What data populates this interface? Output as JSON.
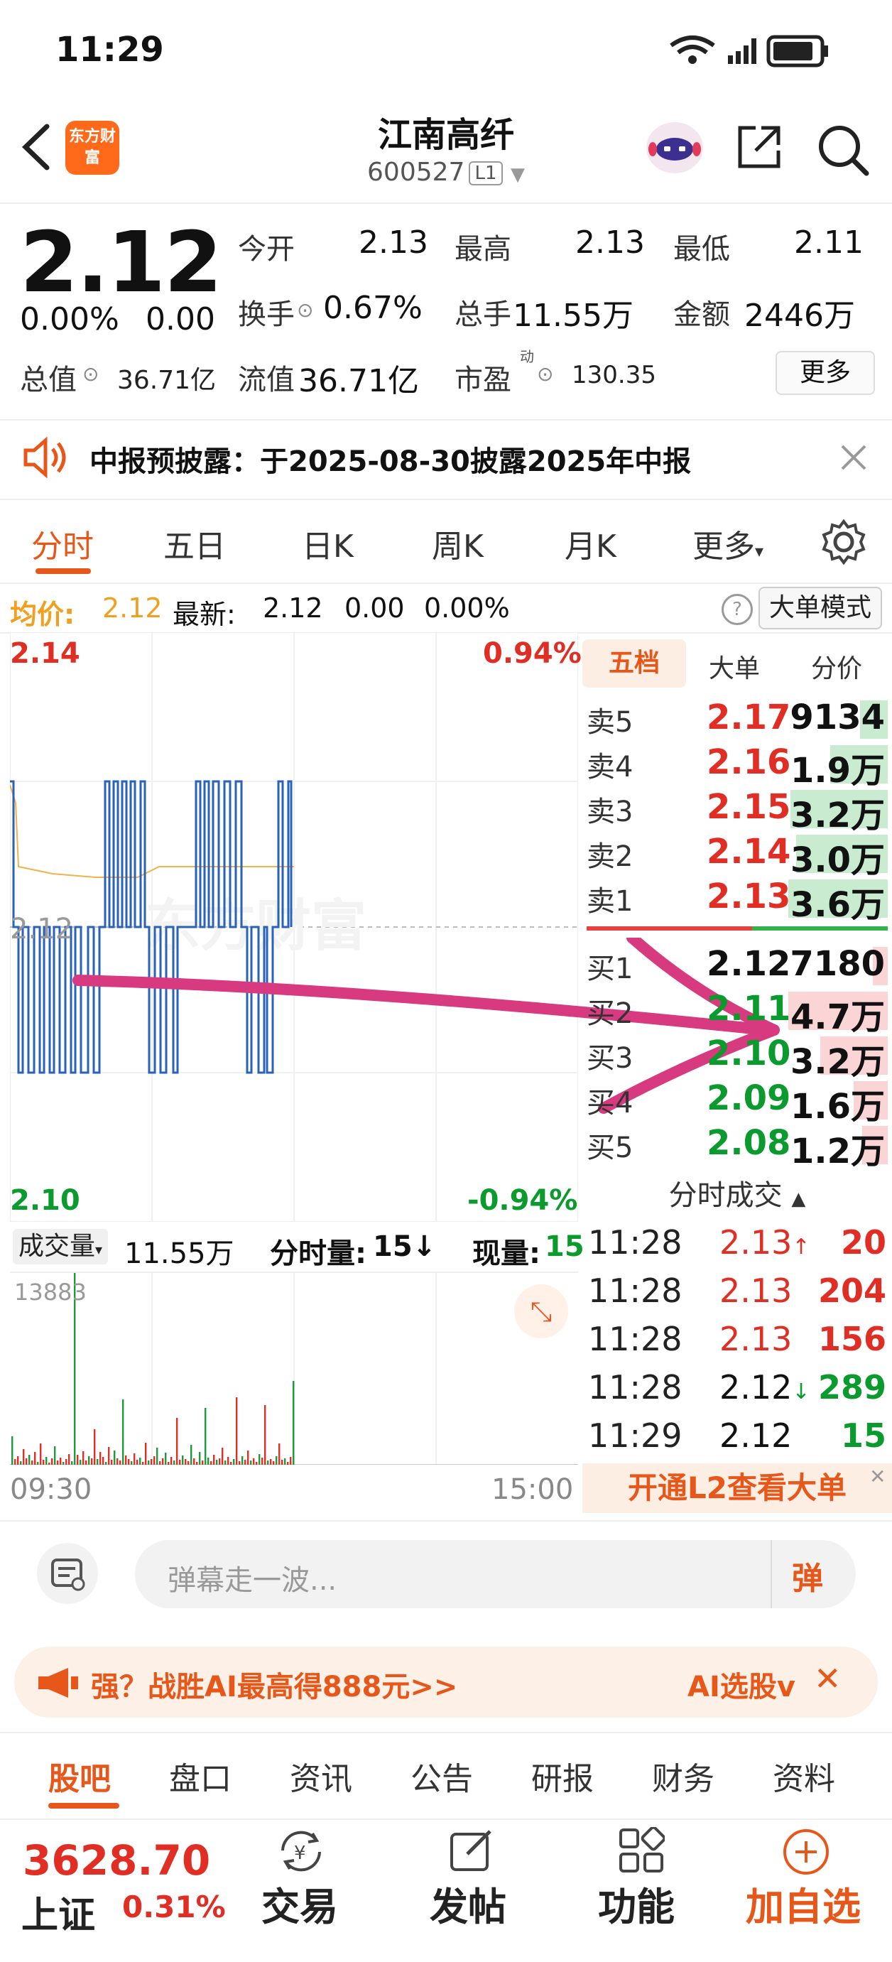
{
  "status": {
    "time": "11:29"
  },
  "header": {
    "logo": "东方财富",
    "title": "江南高纤",
    "code": "600527",
    "level": "L1"
  },
  "quote": {
    "price": "2.12",
    "change_pct": "0.00%",
    "change": "0.00",
    "open_label": "今开",
    "open": "2.13",
    "high_label": "最高",
    "high": "2.13",
    "low_label": "最低",
    "low": "2.11",
    "turnover_label": "换手",
    "turnover": "0.67%",
    "volume_label": "总手",
    "volume": "11.55万",
    "amount_label": "金额",
    "amount": "2446万",
    "mktcap_label": "总值",
    "mktcap": "36.71亿",
    "float_label": "流值",
    "float": "36.71亿",
    "pe_label": "市盈",
    "pe_sup": "动",
    "pe": "130.35",
    "more": "更多"
  },
  "notice": {
    "text": "中报预披露：于2025-08-30披露2025年中报"
  },
  "tabs": [
    {
      "label": "分时"
    },
    {
      "label": "五日"
    },
    {
      "label": "日K"
    },
    {
      "label": "周K"
    },
    {
      "label": "月K"
    },
    {
      "label": "更多"
    }
  ],
  "infobar": {
    "avg_label": "均价:",
    "avg": "2.12",
    "latest_label": "最新:",
    "latest": "2.12",
    "chg": "0.00",
    "chg_pct": "0.00%",
    "mode": "大单模式"
  },
  "chart": {
    "top_price": "2.14",
    "top_pct": "0.94%",
    "mid_price": "2.12",
    "bot_price": "2.10",
    "bot_pct": "-0.94%",
    "watermark": "东方财富"
  },
  "volume": {
    "label": "成交量",
    "total": "11.55万",
    "per_min_label": "分时量:",
    "per_min": "15↓",
    "now_label": "现量:",
    "now": "15",
    "max": "13883",
    "start": "09:30",
    "end": "15:00"
  },
  "orderbook": {
    "tabs": [
      "五档",
      "大单",
      "分价"
    ],
    "asks": [
      {
        "k": "卖5",
        "p": "2.17",
        "v": "9134",
        "w": 0.28
      },
      {
        "k": "卖4",
        "p": "2.16",
        "v": "1.9万",
        "w": 0.58
      },
      {
        "k": "卖3",
        "p": "2.15",
        "v": "3.2万",
        "w": 0.98
      },
      {
        "k": "卖2",
        "p": "2.14",
        "v": "3.0万",
        "w": 0.92
      },
      {
        "k": "卖1",
        "p": "2.13",
        "v": "3.6万",
        "w": 1.0
      }
    ],
    "bids": [
      {
        "k": "买1",
        "p": "2.12",
        "v": "7180",
        "w": 0.15
      },
      {
        "k": "买2",
        "p": "2.11",
        "v": "4.7万",
        "w": 1.0
      },
      {
        "k": "买3",
        "p": "2.10",
        "v": "3.2万",
        "w": 0.68
      },
      {
        "k": "买4",
        "p": "2.09",
        "v": "1.6万",
        "w": 0.34
      },
      {
        "k": "买5",
        "p": "2.08",
        "v": "1.2万",
        "w": 0.26
      }
    ]
  },
  "trades": {
    "title": "分时成交",
    "rows": [
      {
        "t": "11:28",
        "p": "2.13",
        "arrow": "↑",
        "v": "20",
        "pc": "red",
        "vc": "red"
      },
      {
        "t": "11:28",
        "p": "2.13",
        "arrow": "",
        "v": "204",
        "pc": "red",
        "vc": "red"
      },
      {
        "t": "11:28",
        "p": "2.13",
        "arrow": "",
        "v": "156",
        "pc": "red",
        "vc": "red"
      },
      {
        "t": "11:28",
        "p": "2.12",
        "arrow": "↓",
        "v": "289",
        "pc": "black",
        "vc": "green"
      },
      {
        "t": "11:29",
        "p": "2.12",
        "arrow": "",
        "v": "15",
        "pc": "black",
        "vc": "green"
      }
    ],
    "l2": "开通L2查看大单"
  },
  "comment": {
    "placeholder": "弹幕走一波...",
    "send": "弹"
  },
  "ad": {
    "text": "强？战胜AI最高得888元>>",
    "right": "AI选股v"
  },
  "subtabs": [
    "股吧",
    "盘口",
    "资讯",
    "公告",
    "研报",
    "财务",
    "资料"
  ],
  "index": {
    "value": "3628.70",
    "name": "上证",
    "pct": "0.31%"
  },
  "nav": {
    "trade": "交易",
    "post": "发帖",
    "func": "功能",
    "add": "加自选"
  }
}
